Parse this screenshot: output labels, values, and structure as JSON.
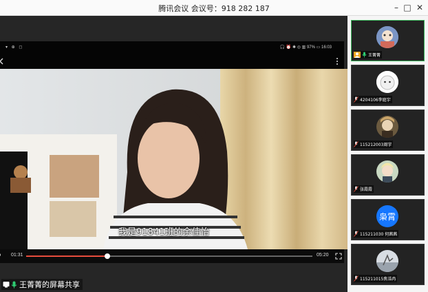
{
  "window": {
    "title": "腾讯会议 会议号：918 282 187",
    "minimize_glyph": "–",
    "maximize_glyph": "□",
    "close_glyph": "✕"
  },
  "phone": {
    "status_left": "▾ ⊕ ◻",
    "status_right": "🎧 ⏰ ✱ ◎ ▥ 97% ▭ 16:03",
    "back_icon": "chevron-left-icon",
    "menu_icon": "more-vertical-icon"
  },
  "video": {
    "subtitle": "我是91841班的余佳怡",
    "current_time": "01:31",
    "total_time": "05:20",
    "progress": 0.284
  },
  "share": {
    "label": "王菁菁的屏幕共享"
  },
  "participants": [
    {
      "name": "王菁菁",
      "active": true,
      "avatar": "character"
    },
    {
      "name": "4204106李庭宇",
      "active": false,
      "avatar": "round-cat"
    },
    {
      "name": "115212003周宇",
      "active": false,
      "avatar": "anime"
    },
    {
      "name": "张霞霞",
      "active": false,
      "avatar": "girl"
    },
    {
      "name": "115211030 何茜茜",
      "active": false,
      "avatar": "text",
      "avatar_text": "枭霄"
    },
    {
      "name": "115211015焦浩冉",
      "active": false,
      "avatar": "sky"
    }
  ],
  "colors": {
    "accent_red": "#e84d3d",
    "active_border": "#3ab45a",
    "avatar_blue": "#1677ff",
    "mic_green": "#2ecc71"
  }
}
